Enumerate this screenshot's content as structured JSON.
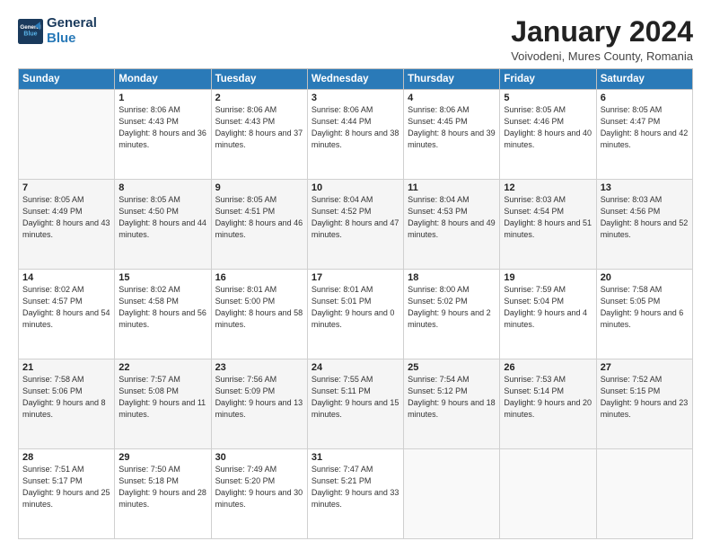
{
  "header": {
    "logo_line1": "General",
    "logo_line2": "Blue",
    "title": "January 2024",
    "location": "Voivodeni, Mures County, Romania"
  },
  "weekdays": [
    "Sunday",
    "Monday",
    "Tuesday",
    "Wednesday",
    "Thursday",
    "Friday",
    "Saturday"
  ],
  "weeks": [
    [
      {
        "day": "",
        "sunrise": "",
        "sunset": "",
        "daylight": ""
      },
      {
        "day": "1",
        "sunrise": "Sunrise: 8:06 AM",
        "sunset": "Sunset: 4:43 PM",
        "daylight": "Daylight: 8 hours and 36 minutes."
      },
      {
        "day": "2",
        "sunrise": "Sunrise: 8:06 AM",
        "sunset": "Sunset: 4:43 PM",
        "daylight": "Daylight: 8 hours and 37 minutes."
      },
      {
        "day": "3",
        "sunrise": "Sunrise: 8:06 AM",
        "sunset": "Sunset: 4:44 PM",
        "daylight": "Daylight: 8 hours and 38 minutes."
      },
      {
        "day": "4",
        "sunrise": "Sunrise: 8:06 AM",
        "sunset": "Sunset: 4:45 PM",
        "daylight": "Daylight: 8 hours and 39 minutes."
      },
      {
        "day": "5",
        "sunrise": "Sunrise: 8:05 AM",
        "sunset": "Sunset: 4:46 PM",
        "daylight": "Daylight: 8 hours and 40 minutes."
      },
      {
        "day": "6",
        "sunrise": "Sunrise: 8:05 AM",
        "sunset": "Sunset: 4:47 PM",
        "daylight": "Daylight: 8 hours and 42 minutes."
      }
    ],
    [
      {
        "day": "7",
        "sunrise": "Sunrise: 8:05 AM",
        "sunset": "Sunset: 4:49 PM",
        "daylight": "Daylight: 8 hours and 43 minutes."
      },
      {
        "day": "8",
        "sunrise": "Sunrise: 8:05 AM",
        "sunset": "Sunset: 4:50 PM",
        "daylight": "Daylight: 8 hours and 44 minutes."
      },
      {
        "day": "9",
        "sunrise": "Sunrise: 8:05 AM",
        "sunset": "Sunset: 4:51 PM",
        "daylight": "Daylight: 8 hours and 46 minutes."
      },
      {
        "day": "10",
        "sunrise": "Sunrise: 8:04 AM",
        "sunset": "Sunset: 4:52 PM",
        "daylight": "Daylight: 8 hours and 47 minutes."
      },
      {
        "day": "11",
        "sunrise": "Sunrise: 8:04 AM",
        "sunset": "Sunset: 4:53 PM",
        "daylight": "Daylight: 8 hours and 49 minutes."
      },
      {
        "day": "12",
        "sunrise": "Sunrise: 8:03 AM",
        "sunset": "Sunset: 4:54 PM",
        "daylight": "Daylight: 8 hours and 51 minutes."
      },
      {
        "day": "13",
        "sunrise": "Sunrise: 8:03 AM",
        "sunset": "Sunset: 4:56 PM",
        "daylight": "Daylight: 8 hours and 52 minutes."
      }
    ],
    [
      {
        "day": "14",
        "sunrise": "Sunrise: 8:02 AM",
        "sunset": "Sunset: 4:57 PM",
        "daylight": "Daylight: 8 hours and 54 minutes."
      },
      {
        "day": "15",
        "sunrise": "Sunrise: 8:02 AM",
        "sunset": "Sunset: 4:58 PM",
        "daylight": "Daylight: 8 hours and 56 minutes."
      },
      {
        "day": "16",
        "sunrise": "Sunrise: 8:01 AM",
        "sunset": "Sunset: 5:00 PM",
        "daylight": "Daylight: 8 hours and 58 minutes."
      },
      {
        "day": "17",
        "sunrise": "Sunrise: 8:01 AM",
        "sunset": "Sunset: 5:01 PM",
        "daylight": "Daylight: 9 hours and 0 minutes."
      },
      {
        "day": "18",
        "sunrise": "Sunrise: 8:00 AM",
        "sunset": "Sunset: 5:02 PM",
        "daylight": "Daylight: 9 hours and 2 minutes."
      },
      {
        "day": "19",
        "sunrise": "Sunrise: 7:59 AM",
        "sunset": "Sunset: 5:04 PM",
        "daylight": "Daylight: 9 hours and 4 minutes."
      },
      {
        "day": "20",
        "sunrise": "Sunrise: 7:58 AM",
        "sunset": "Sunset: 5:05 PM",
        "daylight": "Daylight: 9 hours and 6 minutes."
      }
    ],
    [
      {
        "day": "21",
        "sunrise": "Sunrise: 7:58 AM",
        "sunset": "Sunset: 5:06 PM",
        "daylight": "Daylight: 9 hours and 8 minutes."
      },
      {
        "day": "22",
        "sunrise": "Sunrise: 7:57 AM",
        "sunset": "Sunset: 5:08 PM",
        "daylight": "Daylight: 9 hours and 11 minutes."
      },
      {
        "day": "23",
        "sunrise": "Sunrise: 7:56 AM",
        "sunset": "Sunset: 5:09 PM",
        "daylight": "Daylight: 9 hours and 13 minutes."
      },
      {
        "day": "24",
        "sunrise": "Sunrise: 7:55 AM",
        "sunset": "Sunset: 5:11 PM",
        "daylight": "Daylight: 9 hours and 15 minutes."
      },
      {
        "day": "25",
        "sunrise": "Sunrise: 7:54 AM",
        "sunset": "Sunset: 5:12 PM",
        "daylight": "Daylight: 9 hours and 18 minutes."
      },
      {
        "day": "26",
        "sunrise": "Sunrise: 7:53 AM",
        "sunset": "Sunset: 5:14 PM",
        "daylight": "Daylight: 9 hours and 20 minutes."
      },
      {
        "day": "27",
        "sunrise": "Sunrise: 7:52 AM",
        "sunset": "Sunset: 5:15 PM",
        "daylight": "Daylight: 9 hours and 23 minutes."
      }
    ],
    [
      {
        "day": "28",
        "sunrise": "Sunrise: 7:51 AM",
        "sunset": "Sunset: 5:17 PM",
        "daylight": "Daylight: 9 hours and 25 minutes."
      },
      {
        "day": "29",
        "sunrise": "Sunrise: 7:50 AM",
        "sunset": "Sunset: 5:18 PM",
        "daylight": "Daylight: 9 hours and 28 minutes."
      },
      {
        "day": "30",
        "sunrise": "Sunrise: 7:49 AM",
        "sunset": "Sunset: 5:20 PM",
        "daylight": "Daylight: 9 hours and 30 minutes."
      },
      {
        "day": "31",
        "sunrise": "Sunrise: 7:47 AM",
        "sunset": "Sunset: 5:21 PM",
        "daylight": "Daylight: 9 hours and 33 minutes."
      },
      {
        "day": "",
        "sunrise": "",
        "sunset": "",
        "daylight": ""
      },
      {
        "day": "",
        "sunrise": "",
        "sunset": "",
        "daylight": ""
      },
      {
        "day": "",
        "sunrise": "",
        "sunset": "",
        "daylight": ""
      }
    ]
  ]
}
